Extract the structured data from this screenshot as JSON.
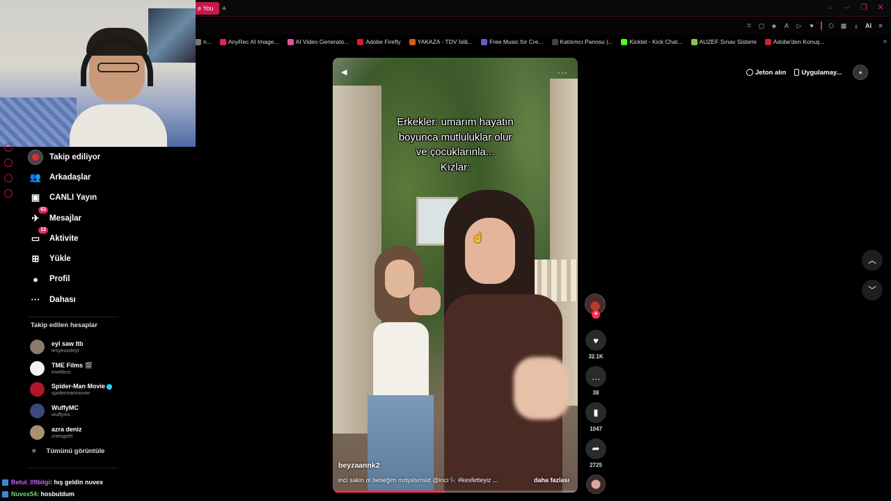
{
  "browser": {
    "active_tab_title": "e You",
    "new_tab_symbol": "+",
    "toolbar_ai_label": "AI",
    "bookmarks": [
      {
        "label": "n...",
        "color": "#777777"
      },
      {
        "label": "AnyRec AI Image...",
        "color": "#e0245e"
      },
      {
        "label": "AI Video Generato...",
        "color": "#e05599"
      },
      {
        "label": "Adobe Firefly",
        "color": "#d3202a"
      },
      {
        "label": "YAKAZA - TDV İslâ...",
        "color": "#d35d1b"
      },
      {
        "label": "Free Music for Cre...",
        "color": "#6a5acd"
      },
      {
        "label": "Katılımcı Panosu |...",
        "color": "#444444"
      },
      {
        "label": "Kicklet - Kick Chat...",
        "color": "#53fc18"
      },
      {
        "label": "AUZEF Sınav Sistemi",
        "color": "#8bc34a"
      },
      {
        "label": "Adobe'den Konuş...",
        "color": "#d3202a"
      }
    ]
  },
  "sidebar": {
    "items": [
      {
        "label": "Takip ediliyor",
        "icon": "avatar-icon",
        "badge": ""
      },
      {
        "label": "Arkadaşlar",
        "icon": "friends-icon",
        "badge": ""
      },
      {
        "label": "CANLI Yayın",
        "icon": "live-icon",
        "badge": ""
      },
      {
        "label": "Mesajlar",
        "icon": "messages-icon",
        "badge": "63"
      },
      {
        "label": "Aktivite",
        "icon": "activity-icon",
        "badge": "12"
      },
      {
        "label": "Yükle",
        "icon": "upload-icon",
        "badge": ""
      },
      {
        "label": "Profil",
        "icon": "profile-icon",
        "badge": ""
      },
      {
        "label": "Dahası",
        "icon": "more-icon",
        "badge": ""
      }
    ],
    "following_title": "Takip edilen hesaplar",
    "following": [
      {
        "name": "eyl saw ltb",
        "user": "iesyeuxdeyl",
        "verified": false,
        "color": "#8a7a6a"
      },
      {
        "name": "TME Films 🎬",
        "user": "tmefilms",
        "verified": false,
        "color": "#f2f2f2"
      },
      {
        "name": "Spider-Man Movie",
        "user": "spidermanmovie",
        "verified": true,
        "color": "#b0162a"
      },
      {
        "name": "WuffyMC",
        "user": "wuffymc",
        "verified": false,
        "color": "#3a4a7a"
      },
      {
        "name": "azra deniz",
        "user": "criesgoth",
        "verified": false,
        "color": "#a89070"
      }
    ],
    "see_all": "Tümünü görüntüle"
  },
  "chat": [
    {
      "user": "Betul_09bilgi",
      "message": ": hış geldin nuvex"
    },
    {
      "user": "Nuvex54",
      "message": ": hosbuldum"
    }
  ],
  "header": {
    "coins_label": "Jeton alın",
    "app_label": "Uygulamay..."
  },
  "video": {
    "caption_lines": [
      "Erkekler: umarım hayatın",
      "boyunca mutluluklar olur",
      "ve çocuklarınla...",
      "Kızlar:"
    ],
    "author": "beyzaannk2",
    "description": "inci sakin ol bebeğim mdşslsmsld @inci🐈‍⬛ #kesfetteyiz ...",
    "more_label": "daha fazlası",
    "progress": 0.45
  },
  "actions": {
    "likes": "32.1K",
    "comments": "38",
    "saves": "1047",
    "shares": "2725"
  }
}
